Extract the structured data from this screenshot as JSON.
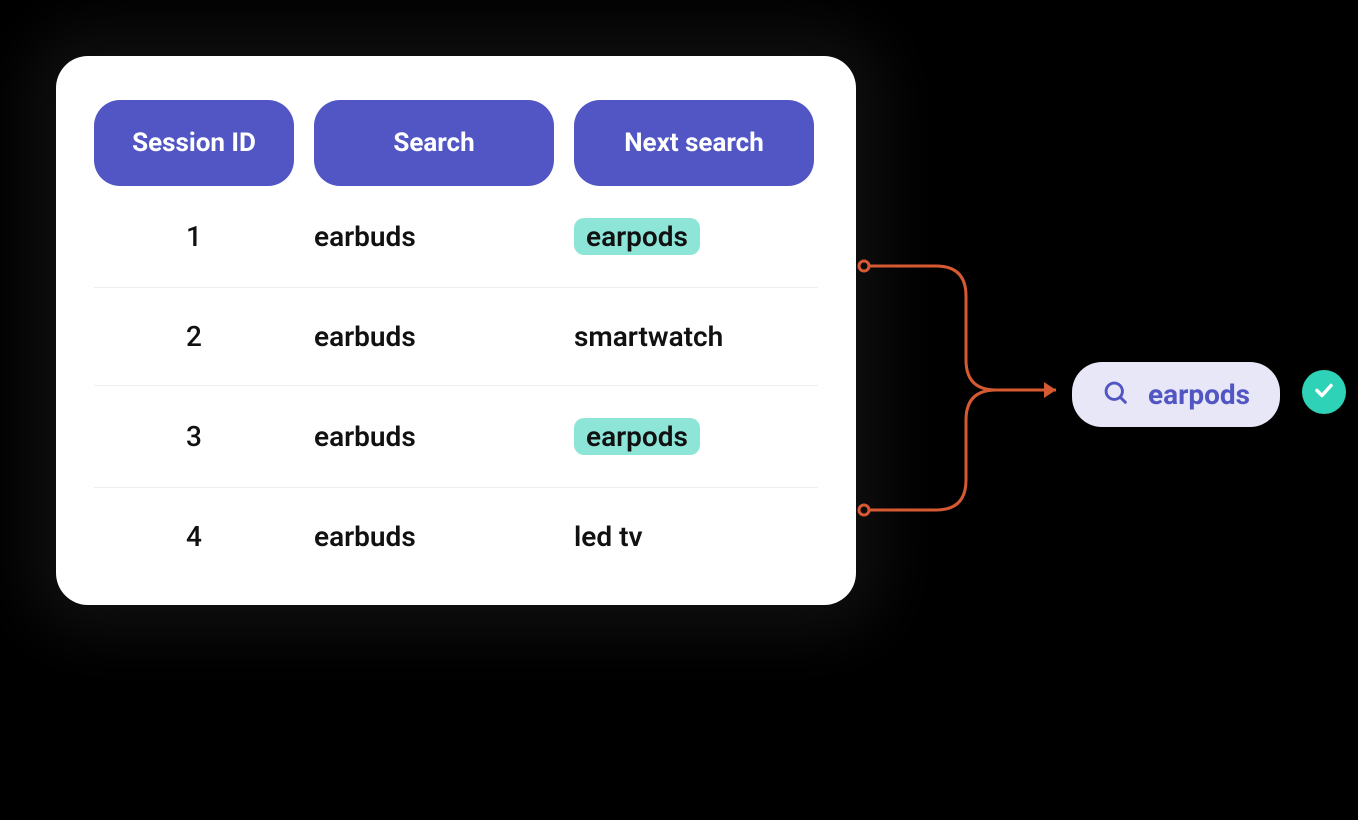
{
  "table": {
    "headers": {
      "session_id": "Session ID",
      "search": "Search",
      "next_search": "Next search"
    },
    "rows": [
      {
        "session": "1",
        "search": "earbuds",
        "next": "earpods",
        "highlight": true
      },
      {
        "session": "2",
        "search": "earbuds",
        "next": "smartwatch",
        "highlight": false
      },
      {
        "session": "3",
        "search": "earbuds",
        "next": "earpods",
        "highlight": true
      },
      {
        "session": "4",
        "search": "earbuds",
        "next": "led tv",
        "highlight": false
      }
    ]
  },
  "result": {
    "label": "earpods"
  },
  "colors": {
    "header": "#5156C4",
    "highlight": "#8DE5D8",
    "result_bg": "#E7E7F7",
    "result_text": "#5156C4",
    "check_bg": "#2ED3B7",
    "connector": "#D65A31"
  }
}
